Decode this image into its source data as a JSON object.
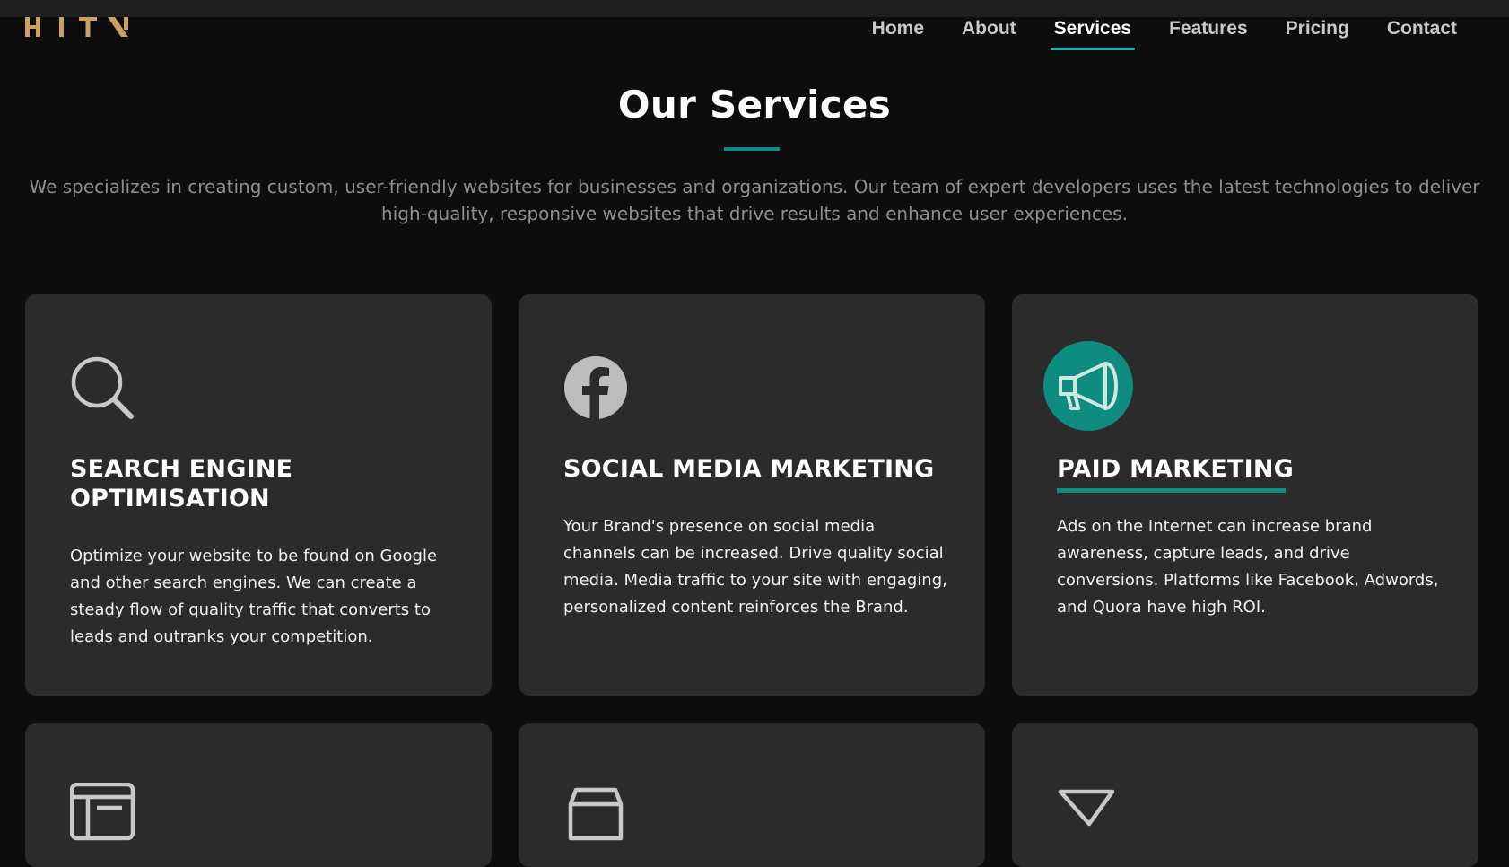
{
  "brand": {
    "logo_text": "HITN",
    "logo_color": "#c9a25e"
  },
  "nav": {
    "items": [
      {
        "label": "Home"
      },
      {
        "label": "About"
      },
      {
        "label": "Services"
      },
      {
        "label": "Features"
      },
      {
        "label": "Pricing"
      },
      {
        "label": "Contact"
      }
    ],
    "active": "Services"
  },
  "section": {
    "title": "Our Services",
    "description": "We specializes in creating custom, user-friendly websites for businesses and organizations. Our team of expert developers uses the latest technologies to deliver high-quality, responsive websites that drive results and enhance user experiences."
  },
  "cards": [
    {
      "icon": "search-icon",
      "title": "SEARCH ENGINE OPTIMISATION",
      "text": "Optimize your website to be found on Google and other search engines. We can create a steady flow of quality traffic that converts to leads and outranks your competition."
    },
    {
      "icon": "facebook-icon",
      "title": "SOCIAL MEDIA MARKETING",
      "text": "Your Brand's presence on social media channels can be increased. Drive quality social media. Media traffic to your site with engaging, personalized content reinforces the Brand."
    },
    {
      "icon": "megaphone-icon",
      "title": "PAID MARKETING",
      "text": "Ads on the Internet can increase brand awareness, capture leads, and drive conversions. Platforms like Facebook, Adwords, and Quora have high ROI."
    },
    {
      "icon": "browser-window-icon"
    },
    {
      "icon": "shopping-bag-icon"
    },
    {
      "icon": "funnel-icon"
    }
  ],
  "colors": {
    "background": "#0d0d0d",
    "card": "#2b2b2b",
    "accent": "#0f8c80",
    "nav_underline": "#14b8a6",
    "muted_text": "#8f8f8f"
  }
}
